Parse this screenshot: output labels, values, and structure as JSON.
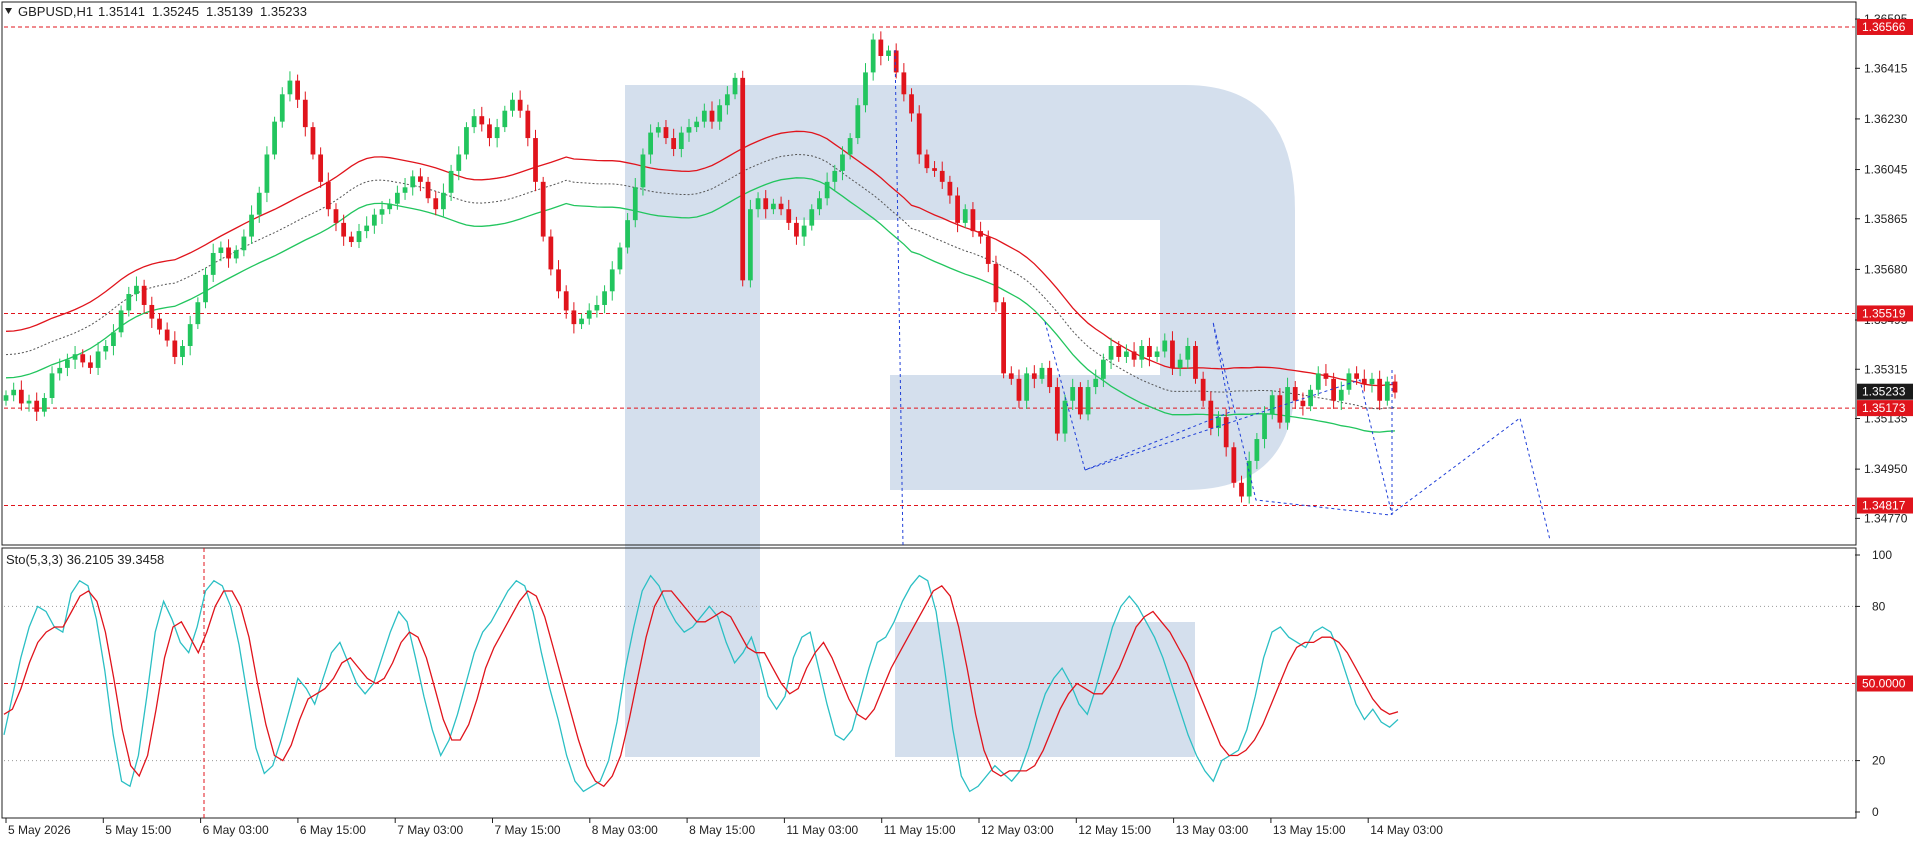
{
  "colors": {
    "bull": "#22c55e",
    "bear": "#e0141c",
    "level": "#e0141c",
    "upper_band": "#e0141c",
    "mid_band": "#555555",
    "lower_band": "#22c55e",
    "forecast": "#1f3fd8",
    "stoch_main": "#2bbfc4",
    "stoch_signal": "#e0141c",
    "watermark": "#cfdceb",
    "price_tag_bg": "#1a1a1a",
    "level_tag_bg": "#e0141c"
  },
  "chart_data": [
    {
      "type": "candlestick",
      "title": "GBPUSD,H1",
      "ohlc_text": [
        "1.35141",
        "1.35245",
        "1.35139",
        "1.35233"
      ],
      "ylim": [
        1.3468,
        1.3665
      ],
      "y_ticks": [
        "1.36595",
        "1.36415",
        "1.36230",
        "1.36045",
        "1.35865",
        "1.35680",
        "1.35495",
        "1.35315",
        "1.35135",
        "1.34950",
        "1.34770"
      ],
      "x_ticks": [
        "5 May 2026",
        "5 May 15:00",
        "6 May 03:00",
        "6 May 15:00",
        "7 May 03:00",
        "7 May 15:00",
        "8 May 03:00",
        "8 May 15:00",
        "11 May 03:00",
        "11 May 15:00",
        "12 May 03:00",
        "12 May 15:00",
        "13 May 03:00",
        "13 May 15:00",
        "14 May 03:00"
      ],
      "levels": [
        {
          "price": 1.36566,
          "label": "1.36566"
        },
        {
          "price": 1.35519,
          "label": "1.35519"
        },
        {
          "price": 1.35173,
          "label": "1.35173"
        },
        {
          "price": 1.34817,
          "label": "1.34817"
        }
      ],
      "current_price": {
        "price": 1.35233,
        "label": "1.35233"
      },
      "closes": [
        1.3522,
        1.3524,
        1.3519,
        1.352,
        1.3516,
        1.3521,
        1.353,
        1.3532,
        1.3535,
        1.3537,
        1.3534,
        1.3532,
        1.3538,
        1.354,
        1.3545,
        1.3553,
        1.3559,
        1.3562,
        1.3555,
        1.355,
        1.3546,
        1.3542,
        1.3536,
        1.354,
        1.3548,
        1.3556,
        1.3566,
        1.3574,
        1.3576,
        1.3572,
        1.3575,
        1.358,
        1.3588,
        1.3596,
        1.361,
        1.3622,
        1.3632,
        1.3637,
        1.363,
        1.362,
        1.361,
        1.36,
        1.359,
        1.3585,
        1.358,
        1.3578,
        1.3582,
        1.3584,
        1.3588,
        1.359,
        1.3592,
        1.3596,
        1.3598,
        1.3602,
        1.36,
        1.3594,
        1.359,
        1.3596,
        1.3604,
        1.361,
        1.362,
        1.3624,
        1.3621,
        1.3616,
        1.362,
        1.3626,
        1.363,
        1.3626,
        1.3616,
        1.36,
        1.358,
        1.3568,
        1.356,
        1.3553,
        1.3548,
        1.355,
        1.3553,
        1.3555,
        1.356,
        1.3568,
        1.3576,
        1.3586,
        1.3598,
        1.361,
        1.3618,
        1.362,
        1.3616,
        1.3612,
        1.3618,
        1.362,
        1.3622,
        1.3626,
        1.3622,
        1.3628,
        1.3632,
        1.3638,
        1.3564,
        1.359,
        1.3594,
        1.359,
        1.3592,
        1.359,
        1.3585,
        1.358,
        1.3584,
        1.359,
        1.3594,
        1.36,
        1.3604,
        1.361,
        1.3616,
        1.3628,
        1.364,
        1.3652,
        1.3646,
        1.3648,
        1.364,
        1.3632,
        1.3625,
        1.361,
        1.3605,
        1.3604,
        1.36,
        1.3595,
        1.3585,
        1.359,
        1.3582,
        1.358,
        1.357,
        1.3556,
        1.353,
        1.3528,
        1.352,
        1.353,
        1.3528,
        1.3532,
        1.3525,
        1.3508,
        1.352,
        1.3525,
        1.3515,
        1.3525,
        1.3528,
        1.3535,
        1.354,
        1.3536,
        1.3538,
        1.3535,
        1.354,
        1.3536,
        1.3538,
        1.3542,
        1.3532,
        1.3535,
        1.354,
        1.3528,
        1.352,
        1.351,
        1.3514,
        1.3503,
        1.349,
        1.3485,
        1.3498,
        1.3506,
        1.3515,
        1.3522,
        1.3512,
        1.3525,
        1.352,
        1.3518,
        1.3524,
        1.353,
        1.3528,
        1.352,
        1.3524,
        1.353,
        1.3528,
        1.3526,
        1.3528,
        1.352,
        1.3527,
        1.3523
      ],
      "stochastic": {
        "label": "Sto(5,3,3) 36.2105 39.3458",
        "ylim": [
          0,
          100
        ],
        "y_ticks": [
          "100",
          "80",
          "20",
          "0"
        ],
        "level_label": "50.0000",
        "main": [
          30,
          45,
          60,
          72,
          80,
          78,
          72,
          70,
          85,
          90,
          88,
          75,
          55,
          30,
          12,
          10,
          22,
          45,
          70,
          82,
          75,
          66,
          62,
          72,
          86,
          90,
          88,
          80,
          65,
          45,
          25,
          15,
          18,
          28,
          40,
          52,
          48,
          42,
          52,
          62,
          66,
          58,
          50,
          46,
          50,
          60,
          70,
          78,
          74,
          60,
          45,
          32,
          22,
          28,
          38,
          50,
          62,
          70,
          74,
          80,
          86,
          90,
          88,
          78,
          62,
          48,
          36,
          22,
          12,
          8,
          10,
          12,
          20,
          35,
          56,
          72,
          86,
          92,
          88,
          80,
          74,
          70,
          72,
          76,
          80,
          76,
          66,
          58,
          62,
          68,
          58,
          45,
          40,
          45,
          60,
          68,
          70,
          56,
          42,
          30,
          28,
          32,
          44,
          56,
          66,
          68,
          74,
          82,
          88,
          92,
          90,
          78,
          56,
          32,
          14,
          8,
          10,
          14,
          18,
          15,
          12,
          16,
          25,
          36,
          46,
          52,
          56,
          50,
          42,
          38,
          48,
          60,
          72,
          80,
          84,
          80,
          74,
          68,
          60,
          50,
          40,
          30,
          22,
          16,
          12,
          20,
          22,
          24,
          32,
          45,
          60,
          70,
          72,
          68,
          66,
          64,
          70,
          72,
          70,
          62,
          52,
          42,
          36,
          40,
          35,
          33,
          36
        ],
        "signal": [
          38,
          40,
          48,
          58,
          66,
          70,
          72,
          72,
          78,
          84,
          86,
          82,
          70,
          52,
          32,
          18,
          14,
          22,
          40,
          60,
          72,
          74,
          68,
          62,
          70,
          80,
          86,
          86,
          80,
          68,
          50,
          34,
          22,
          20,
          26,
          36,
          44,
          46,
          48,
          52,
          58,
          60,
          56,
          52,
          50,
          52,
          58,
          66,
          70,
          68,
          60,
          48,
          36,
          28,
          28,
          34,
          44,
          56,
          64,
          70,
          76,
          82,
          86,
          84,
          76,
          64,
          52,
          40,
          28,
          18,
          12,
          10,
          14,
          22,
          36,
          52,
          68,
          80,
          86,
          86,
          82,
          78,
          74,
          74,
          76,
          78,
          76,
          70,
          64,
          62,
          62,
          56,
          50,
          46,
          48,
          56,
          62,
          66,
          60,
          52,
          44,
          38,
          36,
          40,
          48,
          56,
          62,
          68,
          74,
          80,
          86,
          88,
          84,
          72,
          56,
          38,
          24,
          16,
          14,
          16,
          16,
          16,
          18,
          24,
          32,
          40,
          46,
          50,
          48,
          46,
          46,
          50,
          56,
          64,
          72,
          76,
          78,
          74,
          70,
          64,
          58,
          50,
          42,
          34,
          26,
          22,
          22,
          24,
          28,
          34,
          42,
          50,
          58,
          64,
          66,
          66,
          68,
          68,
          66,
          62,
          56,
          50,
          44,
          40,
          38,
          39
        ]
      }
    }
  ]
}
